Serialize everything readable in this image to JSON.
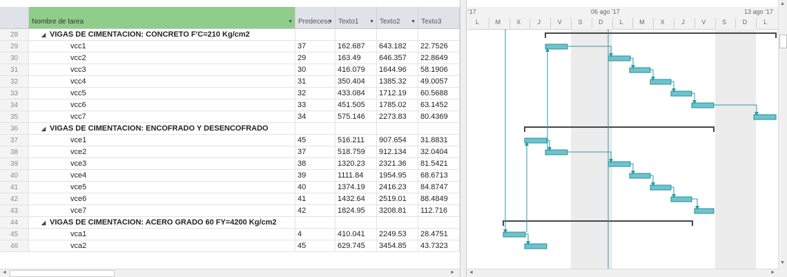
{
  "columns": {
    "name": "Nombre de tarea",
    "pred": "Predecesc",
    "t1": "Texto1",
    "t2": "Texto2",
    "t3": "Texto3"
  },
  "rows": [
    {
      "id": "28",
      "name": "VIGAS DE CIMENTACION: CONCRETO F'C=210 Kg/cm2",
      "summary": true,
      "pred": "",
      "t1": "",
      "t2": "",
      "t3": ""
    },
    {
      "id": "29",
      "name": "vcc1",
      "pred": "37",
      "t1": "162.687",
      "t2": "643.182",
      "t3": "22.7526"
    },
    {
      "id": "30",
      "name": "vcc2",
      "pred": "29",
      "t1": "163.49",
      "t2": "646.357",
      "t3": "22.8649"
    },
    {
      "id": "31",
      "name": "vcc3",
      "pred": "30",
      "t1": "416.079",
      "t2": "1644.96",
      "t3": "58.1906"
    },
    {
      "id": "32",
      "name": "vcc4",
      "pred": "31",
      "t1": "350.404",
      "t2": "1385.32",
      "t3": "49.0057"
    },
    {
      "id": "33",
      "name": "vcc5",
      "pred": "32",
      "t1": "433.084",
      "t2": "1712.19",
      "t3": "60.5688"
    },
    {
      "id": "34",
      "name": "vcc6",
      "pred": "33",
      "t1": "451.505",
      "t2": "1785.02",
      "t3": "63.1452"
    },
    {
      "id": "35",
      "name": "vcc7",
      "pred": "34",
      "t1": "575.146",
      "t2": "2273.83",
      "t3": "80.4369"
    },
    {
      "id": "36",
      "name": "VIGAS DE CIMENTACION: ENCOFRADO Y DESENCOFRADO",
      "summary": true,
      "pred": "",
      "t1": "",
      "t2": "",
      "t3": ""
    },
    {
      "id": "37",
      "name": "vce1",
      "pred": "45",
      "t1": "516.211",
      "t2": "907.654",
      "t3": "31.8831"
    },
    {
      "id": "38",
      "name": "vce2",
      "pred": "37",
      "t1": "518.759",
      "t2": "912.134",
      "t3": "32.0404"
    },
    {
      "id": "39",
      "name": "vce3",
      "pred": "38",
      "t1": "1320.23",
      "t2": "2321.36",
      "t3": "81.5421"
    },
    {
      "id": "40",
      "name": "vce4",
      "pred": "39",
      "t1": "1111.84",
      "t2": "1954.95",
      "t3": "68.6713"
    },
    {
      "id": "41",
      "name": "vce5",
      "pred": "40",
      "t1": "1374.19",
      "t2": "2416.23",
      "t3": "84.8747"
    },
    {
      "id": "42",
      "name": "vce6",
      "pred": "41",
      "t1": "1432.64",
      "t2": "2519.01",
      "t3": "88.4849"
    },
    {
      "id": "43",
      "name": "vce7",
      "pred": "42",
      "t1": "1824.95",
      "t2": "3208.81",
      "t3": "112.716"
    },
    {
      "id": "44",
      "name": "VIGAS DE CIMENTACION: ACERO GRADO 60 FY=4200 Kg/cm2",
      "summary": true,
      "pred": "",
      "t1": "",
      "t2": "",
      "t3": ""
    },
    {
      "id": "45",
      "name": "vca1",
      "pred": "4",
      "t1": "410.041",
      "t2": "2249.53",
      "t3": "28.4751"
    },
    {
      "id": "46",
      "name": "vca2",
      "pred": "45",
      "t1": "629.745",
      "t2": "3454.85",
      "t3": "43.7323"
    }
  ],
  "timescale": {
    "weeks": [
      "'17",
      "06 ago '17",
      "13 ago '17"
    ],
    "days": [
      "L",
      "M",
      "X",
      "J",
      "V",
      "S",
      "D",
      "L",
      "M",
      "X",
      "J",
      "V",
      "S",
      "D",
      "L"
    ]
  },
  "colors": {
    "bar": "#6cc4cc",
    "bar_border": "#2a8e98",
    "summary": "#444444",
    "link": "#2a9aa4",
    "name_header": "#8fcd8a"
  },
  "scroll": {
    "up": "▲",
    "down": "▼",
    "left": "◄",
    "right": "►"
  }
}
